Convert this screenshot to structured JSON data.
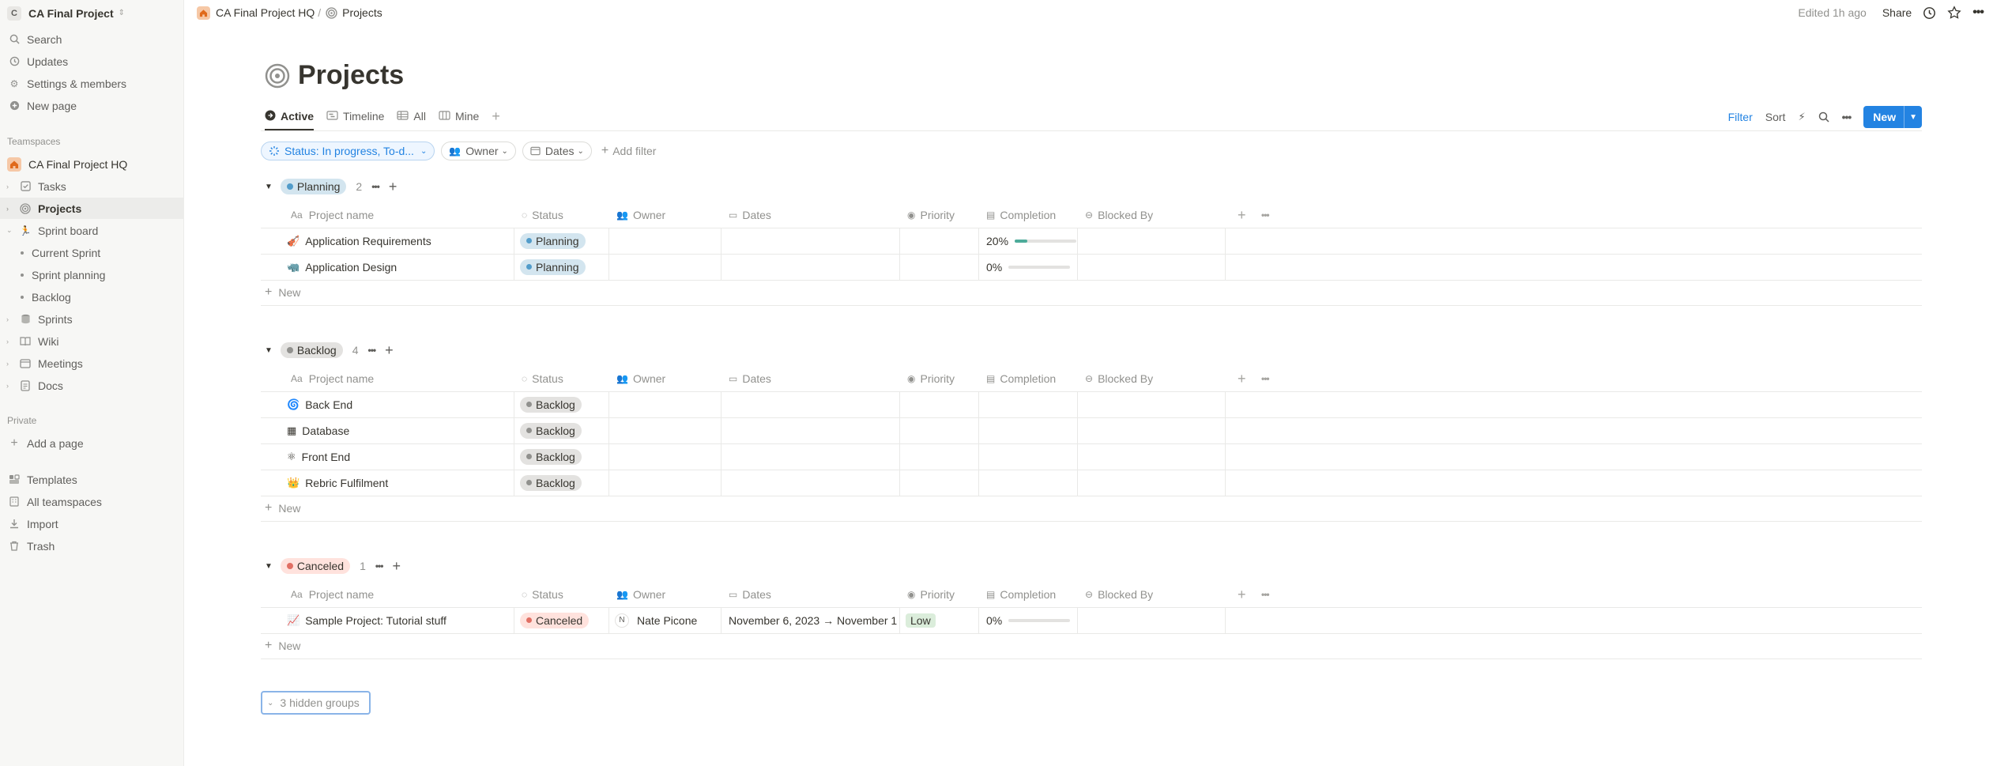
{
  "workspace": {
    "badge": "C",
    "name": "CA Final Project"
  },
  "sidebar": {
    "top_items": [
      {
        "label": "Search",
        "icon": "search-icon"
      },
      {
        "label": "Updates",
        "icon": "clock-icon"
      },
      {
        "label": "Settings & members",
        "icon": "gear-icon"
      },
      {
        "label": "New page",
        "icon": "plus-circle-icon"
      }
    ],
    "teamspaces_label": "Teamspaces",
    "teamspace_home": "CA Final Project HQ",
    "tree": [
      {
        "label": "Tasks",
        "icon": "checkbox-icon"
      },
      {
        "label": "Projects",
        "icon": "target-icon"
      },
      {
        "label": "Sprint board",
        "icon": "runner-icon"
      },
      {
        "label": "Current Sprint"
      },
      {
        "label": "Sprint planning"
      },
      {
        "label": "Backlog"
      },
      {
        "label": "Sprints",
        "icon": "stack-icon"
      },
      {
        "label": "Wiki",
        "icon": "book-icon"
      },
      {
        "label": "Meetings",
        "icon": "calendar-icon"
      },
      {
        "label": "Docs",
        "icon": "doc-icon"
      }
    ],
    "private_label": "Private",
    "add_page": "Add a page",
    "bottom_items": [
      {
        "label": "Templates"
      },
      {
        "label": "All teamspaces"
      },
      {
        "label": "Import"
      },
      {
        "label": "Trash"
      }
    ]
  },
  "topbar": {
    "crumb1": "CA Final Project HQ",
    "sep": "/",
    "crumb2": "Projects",
    "edited": "Edited 1h ago",
    "share": "Share"
  },
  "page": {
    "title": "Projects"
  },
  "views": {
    "tabs": [
      "Active",
      "Timeline",
      "All",
      "Mine"
    ],
    "filter": "Filter",
    "sort": "Sort",
    "new": "New"
  },
  "filters": {
    "status": "Status: In progress, To-d...",
    "owner": "Owner",
    "dates": "Dates",
    "add": "Add filter"
  },
  "columns": {
    "name": "Project name",
    "status": "Status",
    "owner": "Owner",
    "dates": "Dates",
    "priority": "Priority",
    "completion": "Completion",
    "blocked": "Blocked By",
    "name_prefix": "Aa"
  },
  "groups": [
    {
      "name": "Planning",
      "count": "2",
      "color": "#529cca",
      "bg": "#d3e5ef",
      "rows": [
        {
          "emoji": "🎻",
          "name": "Application Requirements",
          "status": "Planning",
          "owner": "",
          "owner_initial": "",
          "dates": "",
          "priority": "",
          "completion": "20%",
          "pct": 0.2
        },
        {
          "emoji": "🦏",
          "name": "Application Design",
          "status": "Planning",
          "owner": "",
          "owner_initial": "",
          "dates": "",
          "priority": "",
          "completion": "0%",
          "pct": 0
        }
      ]
    },
    {
      "name": "Backlog",
      "count": "4",
      "color": "#91918e",
      "bg": "#e3e2e0",
      "rows": [
        {
          "emoji": "🌀",
          "name": "Back End",
          "status": "Backlog",
          "owner": "",
          "owner_initial": "",
          "dates": "",
          "priority": "",
          "completion": "",
          "pct": null
        },
        {
          "emoji": "▦",
          "name": "Database",
          "status": "Backlog",
          "owner": "",
          "owner_initial": "",
          "dates": "",
          "priority": "",
          "completion": "",
          "pct": null
        },
        {
          "emoji": "⚛",
          "name": "Front End",
          "status": "Backlog",
          "owner": "",
          "owner_initial": "",
          "dates": "",
          "priority": "",
          "completion": "",
          "pct": null
        },
        {
          "emoji": "👑",
          "name": "Rebric Fulfilment",
          "status": "Backlog",
          "owner": "",
          "owner_initial": "",
          "dates": "",
          "priority": "",
          "completion": "",
          "pct": null
        }
      ]
    },
    {
      "name": "Canceled",
      "count": "1",
      "color": "#e16f64",
      "bg": "#ffe2dd",
      "rows": [
        {
          "emoji": "📈",
          "name": "Sample Project: Tutorial stuff",
          "status": "Canceled",
          "owner": "Nate Picone",
          "owner_initial": "N",
          "dates": "November 6, 2023 → November 1",
          "priority": "Low",
          "completion": "0%",
          "pct": 0
        }
      ]
    }
  ],
  "new_row_label": "New",
  "hidden_groups": "3 hidden groups"
}
